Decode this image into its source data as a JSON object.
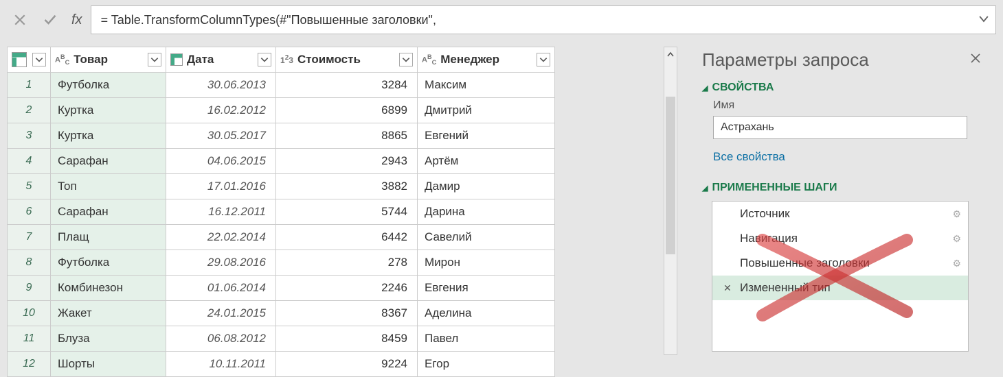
{
  "formula": {
    "text": "= Table.TransformColumnTypes(#\"Повышенные заголовки\","
  },
  "columns": {
    "tovar": "Товар",
    "data": "Дата",
    "stoim": "Стоимость",
    "manager": "Менеджер"
  },
  "rows": [
    {
      "n": "1",
      "tovar": "Футболка",
      "date": "30.06.2013",
      "cost": "3284",
      "mgr": "Максим"
    },
    {
      "n": "2",
      "tovar": "Куртка",
      "date": "16.02.2012",
      "cost": "6899",
      "mgr": "Дмитрий"
    },
    {
      "n": "3",
      "tovar": "Куртка",
      "date": "30.05.2017",
      "cost": "8865",
      "mgr": "Евгений"
    },
    {
      "n": "4",
      "tovar": "Сарафан",
      "date": "04.06.2015",
      "cost": "2943",
      "mgr": "Артём"
    },
    {
      "n": "5",
      "tovar": "Топ",
      "date": "17.01.2016",
      "cost": "3882",
      "mgr": "Дамир"
    },
    {
      "n": "6",
      "tovar": "Сарафан",
      "date": "16.12.2011",
      "cost": "5744",
      "mgr": "Дарина"
    },
    {
      "n": "7",
      "tovar": "Плащ",
      "date": "22.02.2014",
      "cost": "6442",
      "mgr": "Савелий"
    },
    {
      "n": "8",
      "tovar": "Футболка",
      "date": "29.08.2016",
      "cost": "278",
      "mgr": "Мирон"
    },
    {
      "n": "9",
      "tovar": "Комбинезон",
      "date": "01.06.2014",
      "cost": "2246",
      "mgr": "Евгения"
    },
    {
      "n": "10",
      "tovar": "Жакет",
      "date": "24.01.2015",
      "cost": "8367",
      "mgr": "Аделина"
    },
    {
      "n": "11",
      "tovar": "Блуза",
      "date": "06.08.2012",
      "cost": "8459",
      "mgr": "Павел"
    },
    {
      "n": "12",
      "tovar": "Шорты",
      "date": "10.11.2011",
      "cost": "9224",
      "mgr": "Егор"
    }
  ],
  "panel": {
    "title": "Параметры запроса",
    "section_props": "СВОЙСТВА",
    "name_label": "Имя",
    "name_value": "Астрахань",
    "all_props": "Все свойства",
    "section_steps": "ПРИМЕНЕННЫЕ ШАГИ",
    "steps": [
      {
        "label": "Источник",
        "gear": true
      },
      {
        "label": "Навигация",
        "gear": true
      },
      {
        "label": "Повышенные заголовки",
        "gear": true
      },
      {
        "label": "Измененный тип",
        "gear": false,
        "selected": true
      }
    ]
  },
  "icons": {
    "fx": "fx",
    "abc": "ABC",
    "num": "1²3"
  }
}
